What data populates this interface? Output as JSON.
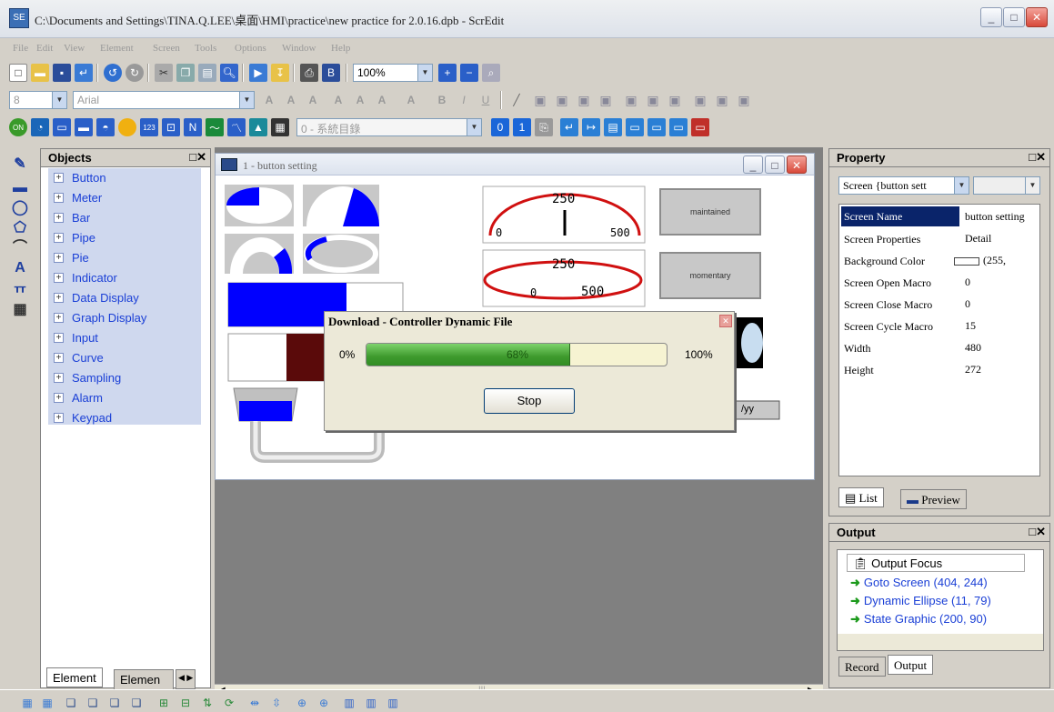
{
  "window": {
    "title": "C:\\Documents and Settings\\TINA.Q.LEE\\桌面\\HMI\\practice\\new practice for 2.0.16.dpb - ScrEdit",
    "app_icon": "SE"
  },
  "menu": [
    "File",
    "Edit",
    "View",
    "Element",
    "Screen",
    "Tools",
    "Options",
    "Window",
    "Help"
  ],
  "toolbar": {
    "zoom": "100%",
    "font_size": "8",
    "font_name": "Arial",
    "screen_combo": "0 - 系統目錄"
  },
  "objects_panel": {
    "title": "Objects",
    "items": [
      "Button",
      "Meter",
      "Bar",
      "Pipe",
      "Pie",
      "Indicator",
      "Data Display",
      "Graph Display",
      "Input",
      "Curve",
      "Sampling",
      "Alarm",
      "Keypad"
    ],
    "tabs": [
      "Element",
      "Elemen"
    ]
  },
  "screen_window": {
    "title": "1 - button setting",
    "buttons": [
      "maintained",
      "momentary"
    ],
    "meter1": {
      "max_label": "250",
      "left": "0",
      "right": "500"
    },
    "meter2": {
      "max_label": "250",
      "left": "0",
      "right": "500"
    },
    "date_label": "/yy"
  },
  "dialog": {
    "title": "Download - Controller Dynamic File",
    "min_label": "0%",
    "max_label": "100%",
    "progress": 0.68,
    "progress_text": "68%",
    "stop_label": "Stop"
  },
  "property_panel": {
    "title": "Property",
    "selector": "Screen {button sett",
    "rows": [
      {
        "key": "Screen Name",
        "value": "button setting"
      },
      {
        "key": "Screen Properties",
        "value": "Detail"
      },
      {
        "key": "Background Color",
        "value": "(255,"
      },
      {
        "key": "Screen Open Macro",
        "value": "0"
      },
      {
        "key": "Screen Close Macro",
        "value": "0"
      },
      {
        "key": "Screen Cycle Macro",
        "value": "15"
      },
      {
        "key": "Width",
        "value": "480"
      },
      {
        "key": "Height",
        "value": "272"
      }
    ],
    "tabs": [
      "List",
      "Preview"
    ]
  },
  "output_panel": {
    "title": "Output",
    "focus_label": "Output Focus",
    "items": [
      "Goto Screen (404, 244)",
      "Dynamic Ellipse (11, 79)",
      "State Graphic (200, 90)"
    ],
    "tabs": [
      "Record",
      "Output"
    ]
  },
  "colors": {
    "accent_blue": "#0000ff",
    "progress_green": "#3e9a2d",
    "selected_row": "#0a246a"
  }
}
